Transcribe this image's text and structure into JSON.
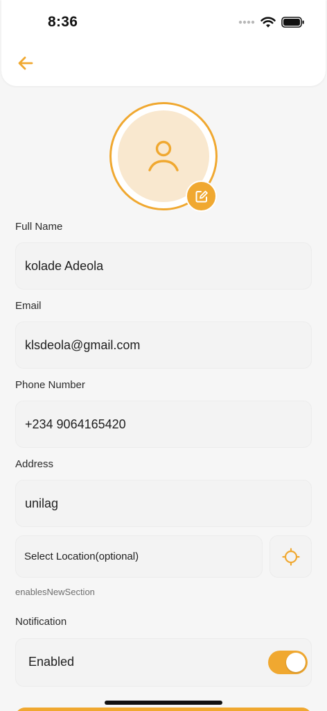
{
  "status_bar": {
    "time": "8:36"
  },
  "colors": {
    "accent": "#f0a830",
    "avatar_bg": "#f9e8cf",
    "field_bg": "#f3f3f3"
  },
  "icons": {
    "back": "arrow-left-icon",
    "avatar": "user-icon",
    "edit": "edit-icon",
    "location": "crosshair-icon"
  },
  "form": {
    "full_name": {
      "label": "Full Name",
      "value": "kolade Adeola"
    },
    "email": {
      "label": "Email",
      "value": "klsdeola@gmail.com"
    },
    "phone": {
      "label": "Phone Number",
      "value": "+234 9064165420"
    },
    "address": {
      "label": "Address",
      "value": "unilag"
    },
    "location": {
      "placeholder": "Select Location(optional)"
    },
    "section_hint": "enablesNewSection",
    "notification": {
      "label": "Notification",
      "option_label": "Enabled",
      "enabled": true
    }
  }
}
